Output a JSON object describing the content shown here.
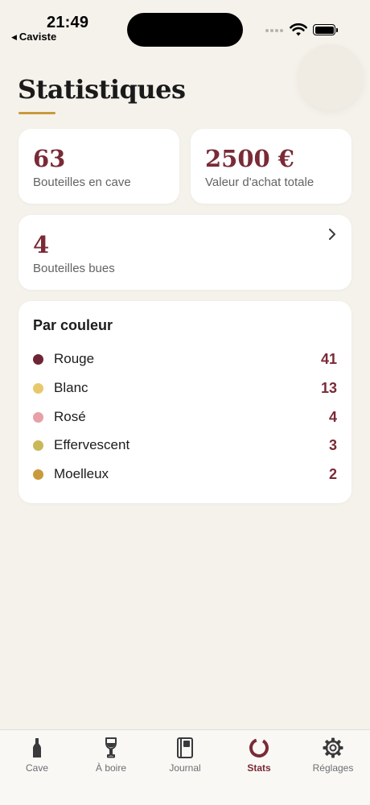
{
  "status_bar": {
    "time": "21:49",
    "back_app": "Caviste"
  },
  "page": {
    "title": "Statistiques"
  },
  "stats": {
    "bottles_in_cellar": {
      "value": "63",
      "label": "Bouteilles en cave"
    },
    "total_purchase_value": {
      "value": "2500 €",
      "label": "Valeur d'achat totale"
    },
    "bottles_drunk": {
      "value": "4",
      "label": "Bouteilles bues"
    }
  },
  "by_color": {
    "title": "Par couleur",
    "items": [
      {
        "name": "Rouge",
        "count": "41",
        "color": "#6e2434"
      },
      {
        "name": "Blanc",
        "count": "13",
        "color": "#e8c96a"
      },
      {
        "name": "Rosé",
        "count": "4",
        "color": "#e6a0a6"
      },
      {
        "name": "Effervescent",
        "count": "3",
        "color": "#c9b85a"
      },
      {
        "name": "Moelleux",
        "count": "2",
        "color": "#c99a3c"
      }
    ]
  },
  "tab_bar": {
    "tabs": [
      {
        "label": "Cave",
        "icon": "bottle-icon"
      },
      {
        "label": "À boire",
        "icon": "wine-glass-icon"
      },
      {
        "label": "Journal",
        "icon": "journal-icon"
      },
      {
        "label": "Stats",
        "icon": "stats-ring-icon"
      },
      {
        "label": "Réglages",
        "icon": "gear-icon"
      }
    ],
    "active_label": "Stats"
  },
  "colors": {
    "accent": "#7a2a36",
    "gold": "#c99a3c",
    "background": "#f5f2ec"
  }
}
